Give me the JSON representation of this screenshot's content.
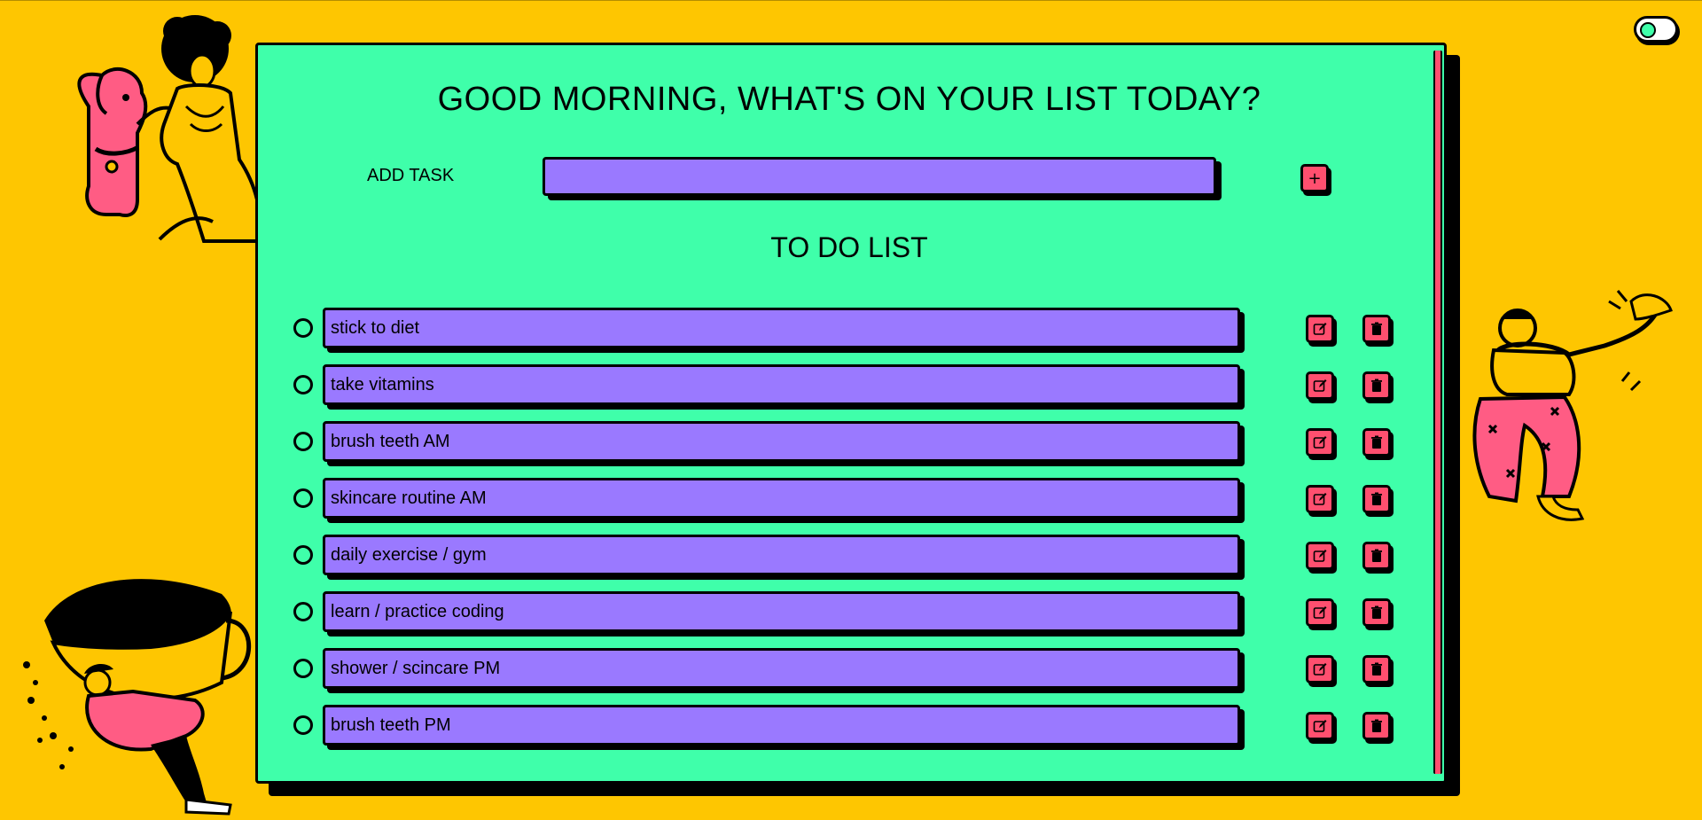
{
  "app": {
    "greeting": "GOOD MORNING, WHAT'S ON YOUR LIST TODAY?",
    "add_task_label": "ADD TASK",
    "add_task_value": "",
    "add_button_symbol": "+",
    "list_title": "TO DO LIST"
  },
  "tasks": [
    {
      "label": "stick to diet"
    },
    {
      "label": "take vitamins"
    },
    {
      "label": "brush teeth AM"
    },
    {
      "label": "skincare routine AM"
    },
    {
      "label": "daily exercise / gym"
    },
    {
      "label": "learn / practice coding"
    },
    {
      "label": "shower / scincare PM"
    },
    {
      "label": "brush teeth PM"
    }
  ],
  "icons": {
    "edit": "edit-icon",
    "delete": "trash-icon",
    "toggle": "theme-toggle"
  },
  "colors": {
    "background": "#FEC601",
    "card": "#3FFFAA",
    "field": "#9A79FF",
    "button": "#FF4F6F",
    "outline": "#000000"
  }
}
